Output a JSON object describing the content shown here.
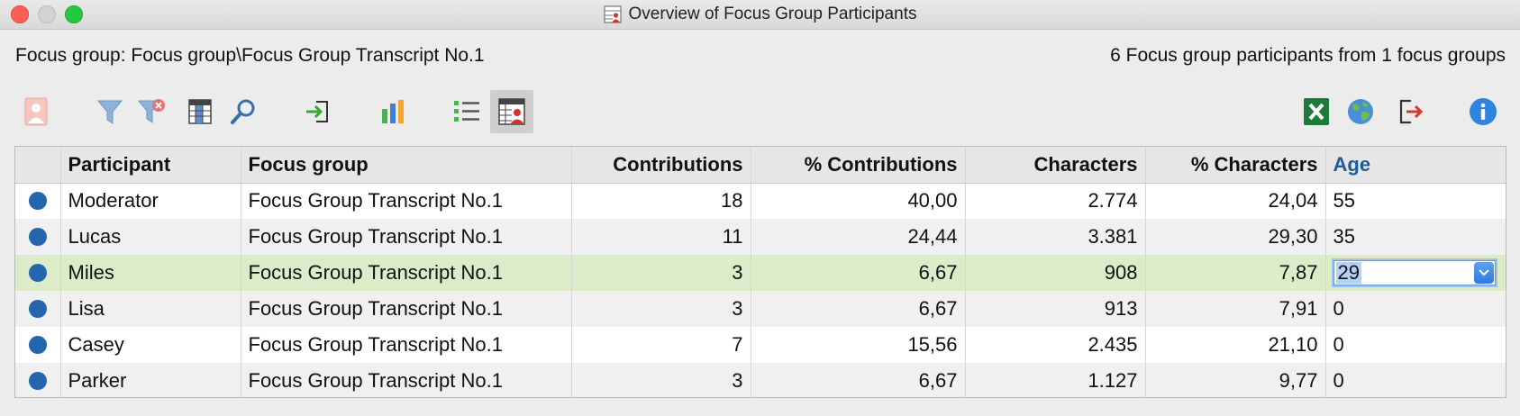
{
  "window": {
    "title": "Overview of Focus Group Participants"
  },
  "info": {
    "focus_group_label": "Focus group: Focus group\\Focus Group Transcript No.1",
    "summary": "6 Focus group participants from 1 focus groups"
  },
  "toolbar": {
    "left_icons": [
      "participant-icon",
      "filter-icon",
      "clear-filter-icon",
      "columns-icon",
      "search-icon",
      "activate-icon",
      "chart-icon",
      "list-view-icon",
      "participant-table-icon"
    ],
    "right_icons": [
      "excel-export-icon",
      "web-export-icon",
      "export-icon",
      "info-icon"
    ]
  },
  "table": {
    "columns": [
      "Participant",
      "Focus group",
      "Contributions",
      "% Contributions",
      "Characters",
      "% Characters",
      "Age"
    ],
    "rows": [
      {
        "participant": "Moderator",
        "focus_group": "Focus Group Transcript No.1",
        "contributions": "18",
        "pct_contributions": "40,00",
        "characters": "2.774",
        "pct_characters": "24,04",
        "age": "55"
      },
      {
        "participant": "Lucas",
        "focus_group": "Focus Group Transcript No.1",
        "contributions": "11",
        "pct_contributions": "24,44",
        "characters": "3.381",
        "pct_characters": "29,30",
        "age": "35"
      },
      {
        "participant": "Miles",
        "focus_group": "Focus Group Transcript No.1",
        "contributions": "3",
        "pct_contributions": "6,67",
        "characters": "908",
        "pct_characters": "7,87",
        "age": "29"
      },
      {
        "participant": "Lisa",
        "focus_group": "Focus Group Transcript No.1",
        "contributions": "3",
        "pct_contributions": "6,67",
        "characters": "913",
        "pct_characters": "7,91",
        "age": "0"
      },
      {
        "participant": "Casey",
        "focus_group": "Focus Group Transcript No.1",
        "contributions": "7",
        "pct_contributions": "15,56",
        "characters": "2.435",
        "pct_characters": "21,10",
        "age": "0"
      },
      {
        "participant": "Parker",
        "focus_group": "Focus Group Transcript No.1",
        "contributions": "3",
        "pct_contributions": "6,67",
        "characters": "1.127",
        "pct_characters": "9,77",
        "age": "0"
      }
    ]
  },
  "colors": {
    "selected_row": "#dcecc8",
    "participant_dot": "#2465ad",
    "age_header": "#1f5a9e",
    "close_button": "#fc5f57",
    "zoom_button": "#27c73f"
  }
}
